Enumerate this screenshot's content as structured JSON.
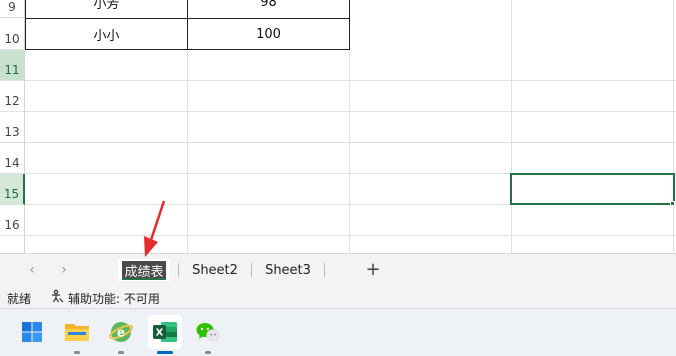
{
  "grid": {
    "row_numbers": [
      "9",
      "10",
      "11",
      "12",
      "13",
      "14",
      "15",
      "16"
    ],
    "rows": [
      {
        "name": "小芳",
        "score": "98"
      },
      {
        "name": "小小",
        "score": "100"
      }
    ]
  },
  "sheet_tabs": [
    "成绩表",
    "Sheet2",
    "Sheet3"
  ],
  "nav": {
    "prev": "‹",
    "next": "›",
    "add": "+"
  },
  "status": {
    "ready": "就绪",
    "accessibility": "辅助功能: 不可用"
  },
  "colors": {
    "accent": "#217346",
    "annotation_arrow": "#e52b2b"
  },
  "taskbar": [
    "windows-start-icon",
    "file-explorer-icon",
    "browser-icon",
    "excel-icon",
    "wechat-icon"
  ]
}
